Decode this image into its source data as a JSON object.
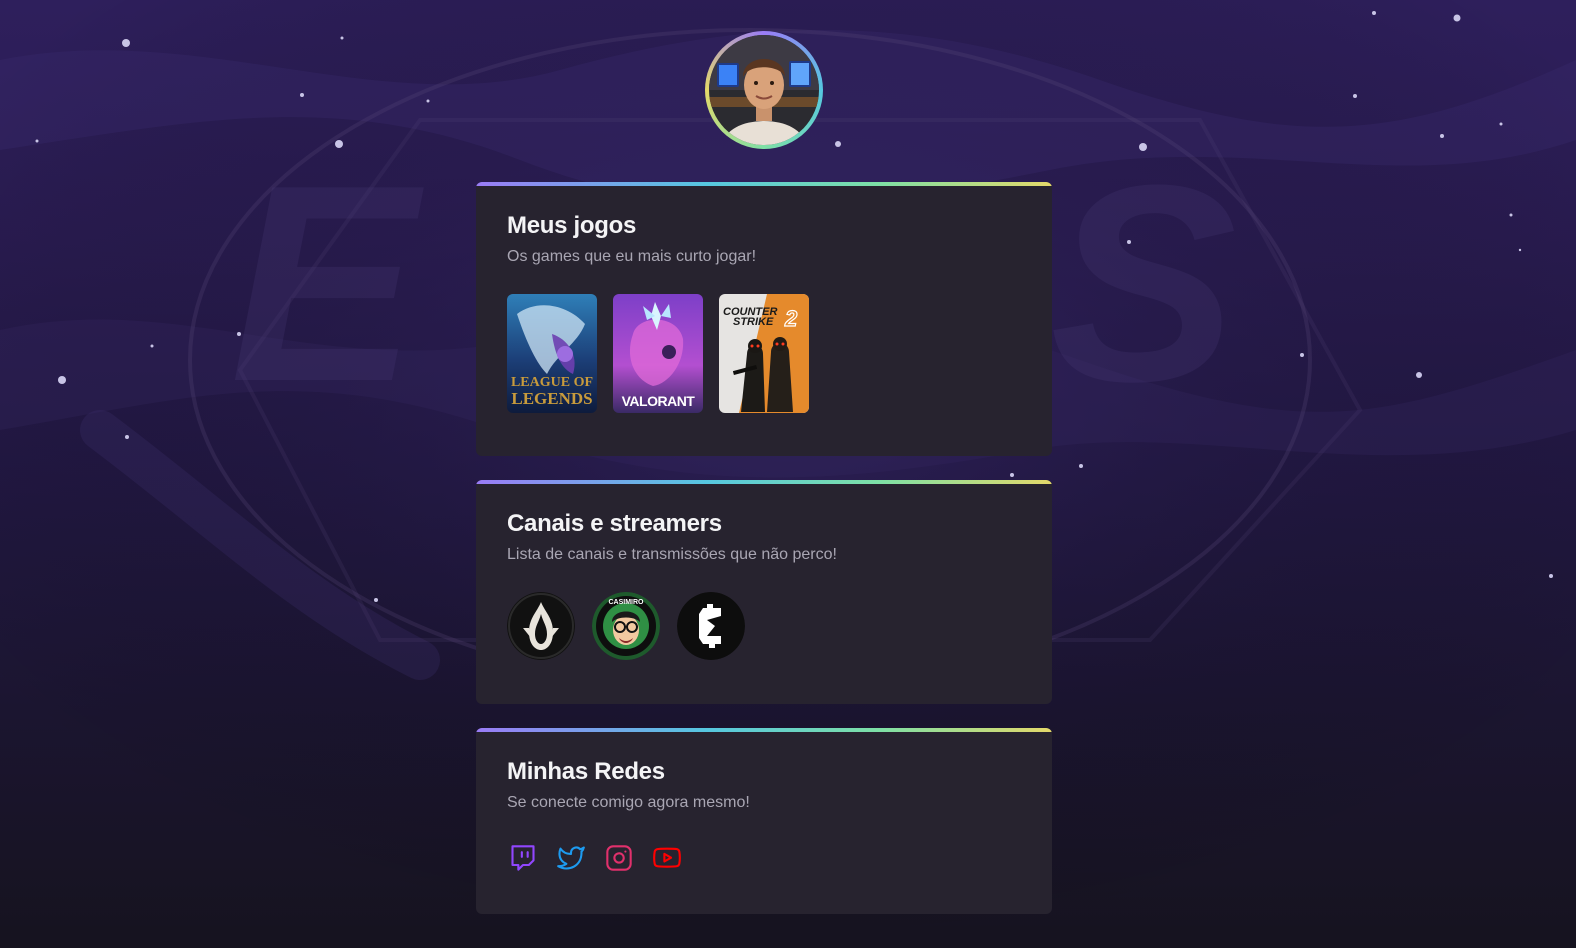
{
  "profile": {
    "avatar_icon": "user-photo"
  },
  "games_section": {
    "title": "Meus jogos",
    "subtitle": "Os games que eu mais curto jogar!",
    "games": [
      {
        "name": "League of Legends",
        "logo_line1": "LEAGUE OF",
        "logo_line2": "LEGENDS"
      },
      {
        "name": "Valorant",
        "logo_text": "VALORANT"
      },
      {
        "name": "Counter Strike 2",
        "logo_line1": "COUNTER",
        "logo_line2": "STRIKE",
        "logo_num": "2"
      }
    ]
  },
  "streamers_section": {
    "title": "Canais e streamers",
    "subtitle": "Lista de canais e transmissões que não perco!",
    "streamers": [
      {
        "icon": "flame-crest-logo"
      },
      {
        "icon": "casimiro-logo",
        "badge_text": "CASIMIRO"
      },
      {
        "icon": "c-bolt-logo"
      }
    ]
  },
  "socials_section": {
    "title": "Minhas Redes",
    "subtitle": "Se conecte comigo agora mesmo!",
    "links": [
      {
        "icon": "twitch-icon",
        "color": "#9146ff"
      },
      {
        "icon": "twitter-icon",
        "color": "#1d9bf0"
      },
      {
        "icon": "instagram-icon",
        "color": "#e1306c"
      },
      {
        "icon": "youtube-icon",
        "color": "#ff0000"
      }
    ]
  },
  "colors": {
    "card_bg": "#27232f",
    "accent_gradient": [
      "#9a7cf6",
      "#56c7e0",
      "#7ee0a6",
      "#e4d96a"
    ]
  }
}
